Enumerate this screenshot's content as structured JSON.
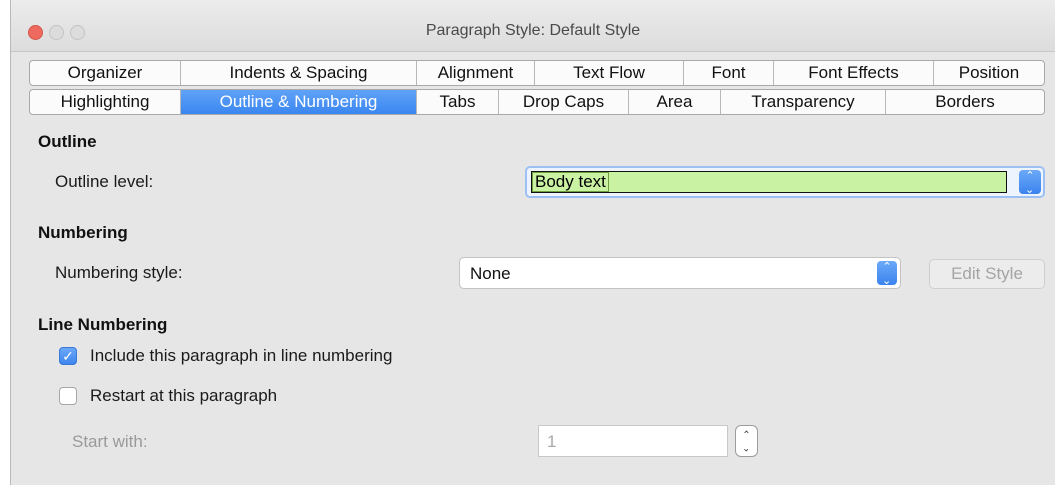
{
  "window": {
    "title": "Paragraph Style: Default Style"
  },
  "tabs": {
    "row1": [
      "Organizer",
      "Indents & Spacing",
      "Alignment",
      "Text Flow",
      "Font",
      "Font Effects",
      "Position"
    ],
    "row2": [
      "Highlighting",
      "Outline & Numbering",
      "Tabs",
      "Drop Caps",
      "Area",
      "Transparency",
      "Borders"
    ],
    "active": "Outline & Numbering"
  },
  "outline": {
    "heading": "Outline",
    "level_label": "Outline level:",
    "level_value": "Body text"
  },
  "numbering": {
    "heading": "Numbering",
    "style_label": "Numbering style:",
    "style_value": "None",
    "edit_button": "Edit Style"
  },
  "line_numbering": {
    "heading": "Line Numbering",
    "include_label": "Include this paragraph in line numbering",
    "include_checked": true,
    "restart_label": "Restart at this paragraph",
    "restart_checked": false,
    "start_with_label": "Start with:",
    "start_with_value": "1"
  },
  "icons": {
    "stepper": "up-down-chevron-icon",
    "checkmark": "checkmark-icon"
  },
  "colors": {
    "active_tab": "#3b86f0",
    "outline_field": "#c9f3a3",
    "close_button": "#ee6a5f"
  }
}
